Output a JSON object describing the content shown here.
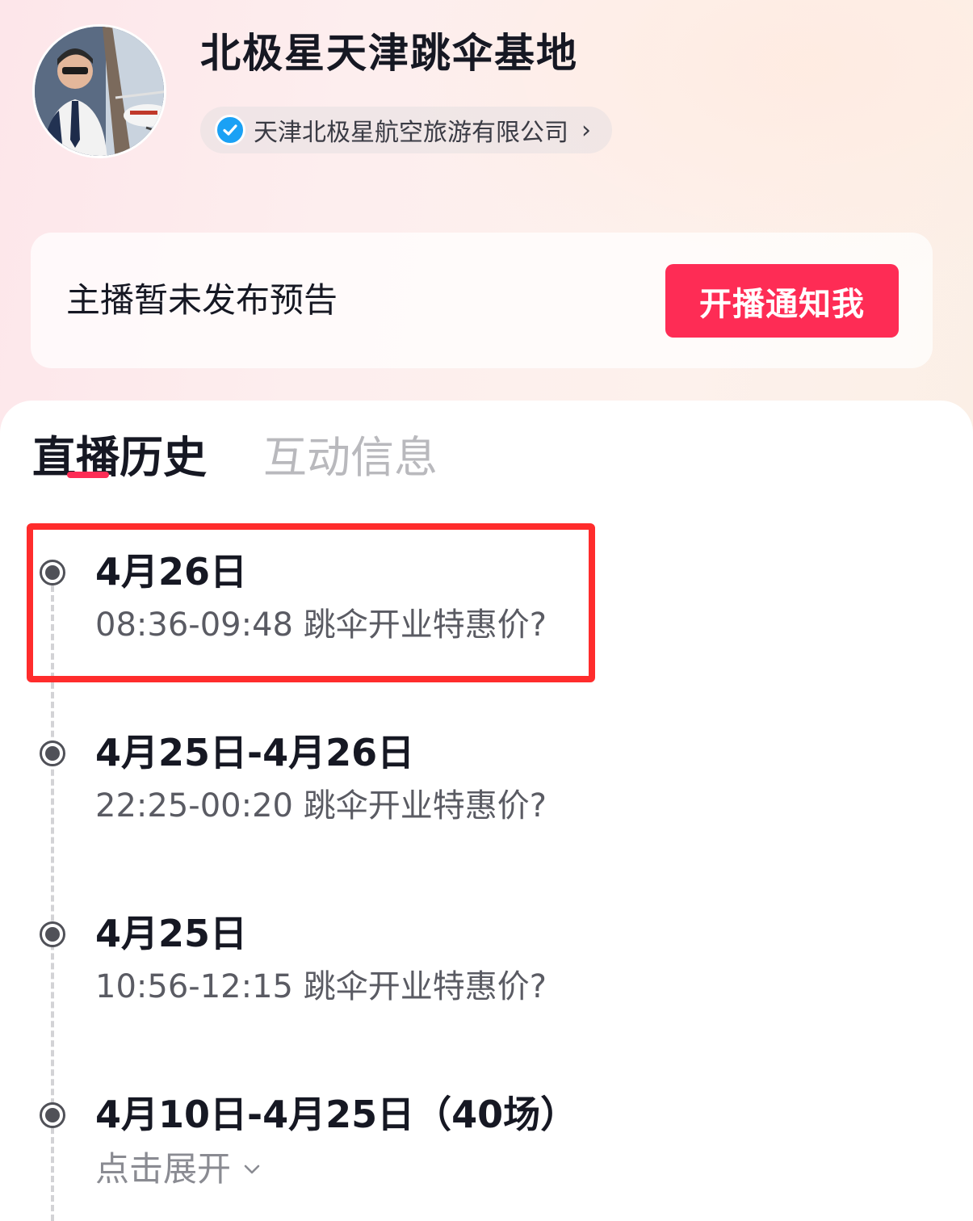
{
  "header": {
    "title": "北极星天津跳伞基地",
    "org_name": "天津北极星航空旅游有限公司",
    "org_arrow": "›"
  },
  "notice": {
    "text": "主播暂未发布预告",
    "button_label": "开播通知我"
  },
  "tabs": [
    {
      "label": "直播历史",
      "active": true
    },
    {
      "label": "互动信息",
      "active": false
    }
  ],
  "history": [
    {
      "date": "4月26日",
      "desc": "08:36-09:48 跳伞开业特惠价?"
    },
    {
      "date": "4月25日-4月26日",
      "desc": "22:25-00:20 跳伞开业特惠价?"
    },
    {
      "date": "4月25日",
      "desc": "10:56-12:15 跳伞开业特惠价?"
    },
    {
      "date": "4月10日-4月25日（40场）",
      "expand_label": "点击展开"
    }
  ],
  "colors": {
    "accent": "#fe2c55",
    "highlight": "#ff2c2c",
    "verified": "#1aa1f5"
  }
}
